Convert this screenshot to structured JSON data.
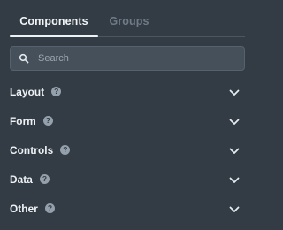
{
  "tabs": [
    {
      "label": "Components",
      "active": true
    },
    {
      "label": "Groups",
      "active": false
    }
  ],
  "search": {
    "placeholder": "Search",
    "value": ""
  },
  "sections": [
    {
      "label": "Layout",
      "help_icon": "question-icon",
      "expand_icon": "chevron-down-icon"
    },
    {
      "label": "Form",
      "help_icon": "question-icon",
      "expand_icon": "chevron-down-icon"
    },
    {
      "label": "Controls",
      "help_icon": "question-icon",
      "expand_icon": "chevron-down-icon"
    },
    {
      "label": "Data",
      "help_icon": "question-icon",
      "expand_icon": "chevron-down-icon"
    },
    {
      "label": "Other",
      "help_icon": "question-icon",
      "expand_icon": "chevron-down-icon"
    }
  ],
  "help_glyph": "?",
  "colors": {
    "background": "#333c45",
    "active_tab_text": "#f1f4f7",
    "inactive_tab_text": "#6f7b86",
    "search_bg": "#46505a",
    "icon": "#c7ced5"
  }
}
